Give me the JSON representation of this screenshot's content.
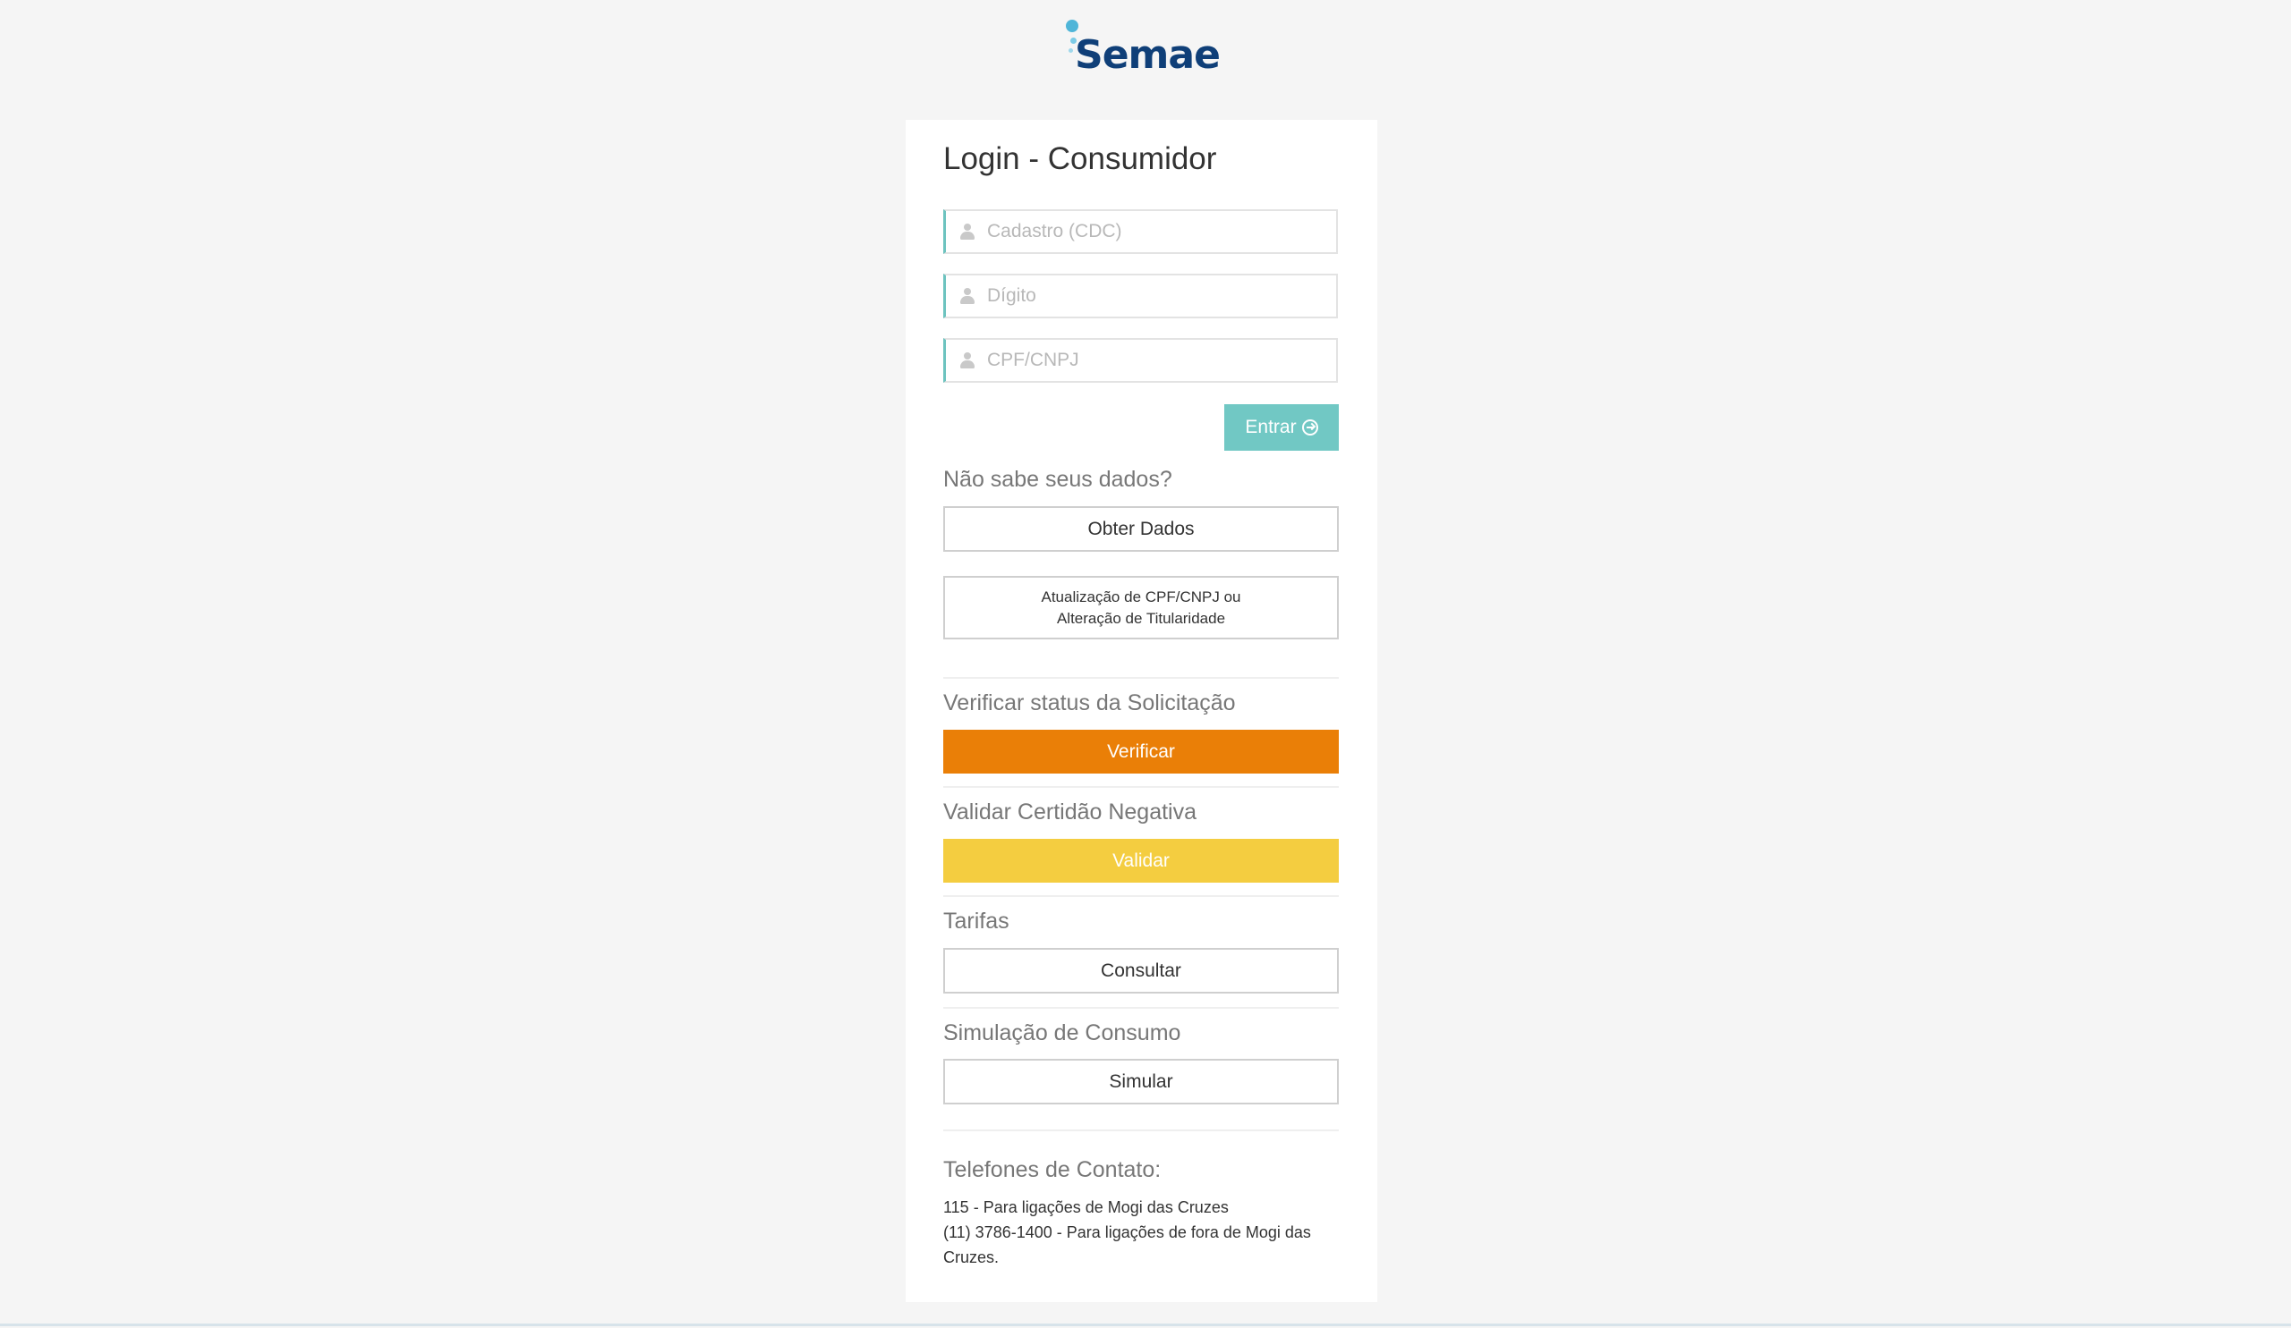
{
  "logo": {
    "text": "Semae",
    "brand_color": "#0f3f78",
    "accent_color": "#4fb5d8"
  },
  "login": {
    "title": "Login - Consumidor",
    "fields": [
      {
        "placeholder": "Cadastro (CDC)",
        "value": "",
        "icon": "user-icon"
      },
      {
        "placeholder": "Dígito",
        "value": "",
        "icon": "user-icon"
      },
      {
        "placeholder": "CPF/CNPJ",
        "value": "",
        "icon": "user-icon"
      }
    ],
    "submit_label": "Entrar",
    "submit_icon": "arrow-circle-right-icon",
    "submit_color": "#71c8c4"
  },
  "help": {
    "question": "Não sabe seus dados?",
    "get_data_label": "Obter Dados",
    "update_line1": "Atualização de CPF/CNPJ ou",
    "update_line2": "Alteração de Titularidade"
  },
  "status": {
    "label": "Verificar status da Solicitação",
    "button": "Verificar",
    "color": "#ea7f07"
  },
  "certidao": {
    "label": "Validar Certidão Negativa",
    "button": "Validar",
    "color": "#f4cd40"
  },
  "tarifas": {
    "label": "Tarifas",
    "button": "Consultar"
  },
  "simulacao": {
    "label": "Simulação de Consumo",
    "button": "Simular"
  },
  "contato": {
    "heading": "Telefones de Contato:",
    "line1": "115 - Para ligações de Mogi das Cruzes",
    "line2": "(11) 3786-1400 - Para ligações de fora de Mogi das Cruzes."
  }
}
